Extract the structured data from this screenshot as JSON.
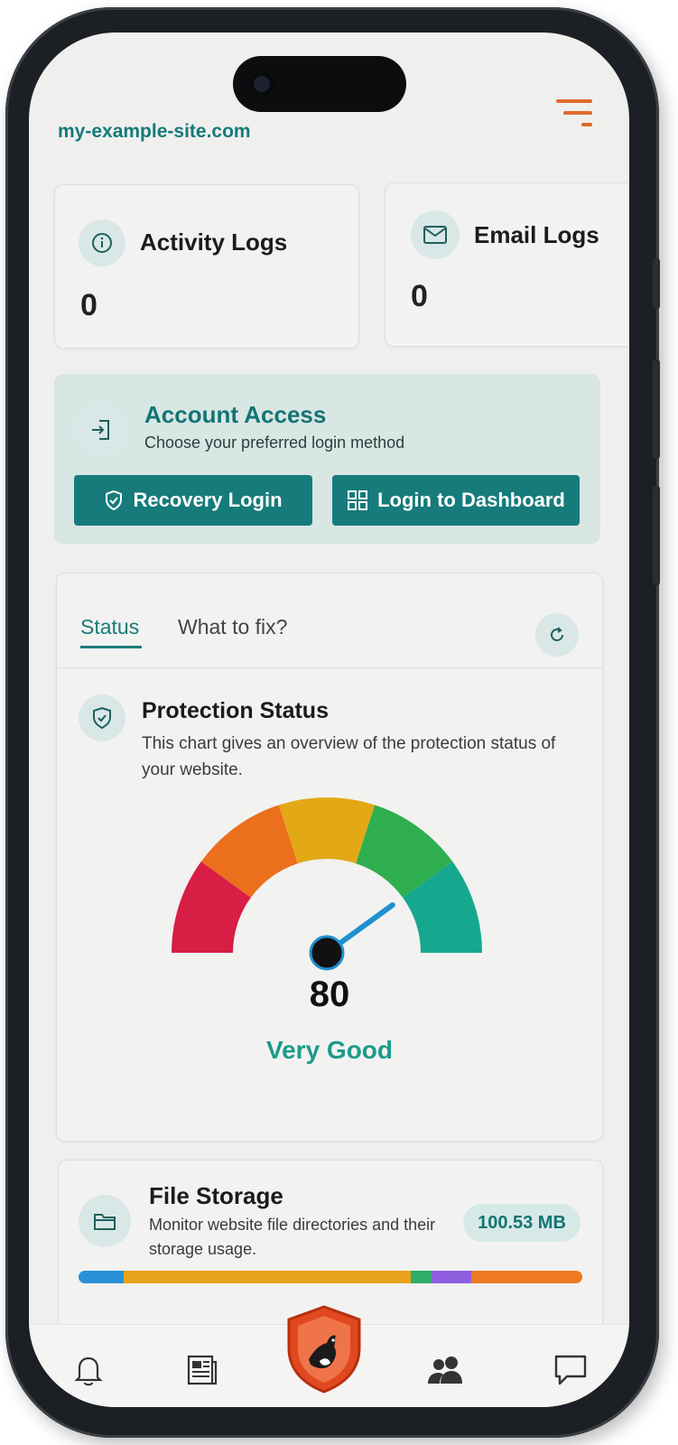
{
  "header": {
    "site_url": "my-example-site.com",
    "menu_icon": "hamburger-menu-icon"
  },
  "log_cards": [
    {
      "title": "Activity Logs",
      "count": "0",
      "icon": "info-icon"
    },
    {
      "title": "Email Logs",
      "count": "0",
      "icon": "mail-icon"
    }
  ],
  "account_access": {
    "title": "Account Access",
    "subtitle": "Choose your preferred login method",
    "icon": "login-icon",
    "recovery_label": "Recovery Login",
    "dashboard_label": "Login to Dashboard"
  },
  "status_panel": {
    "tabs": [
      "Status",
      "What to fix?"
    ],
    "active_tab": "Status",
    "title": "Protection Status",
    "description": "This chart gives an overview of the protection status of your website.",
    "gauge": {
      "value": 80,
      "value_text": "80",
      "max": 100,
      "label": "Very Good",
      "segments": [
        "#d81e45",
        "#ec6f1d",
        "#e3a816",
        "#2eae4f",
        "#16a88e"
      ]
    }
  },
  "file_storage": {
    "title": "File Storage",
    "description": "Monitor website file directories and their storage usage.",
    "size": "100.53 MB",
    "usage_segments": [
      {
        "color": "#2a90d6",
        "fraction": 0.09
      },
      {
        "color": "#e8a21a",
        "fraction": 0.57
      },
      {
        "color": "#2fae6a",
        "fraction": 0.04
      },
      {
        "color": "#8f5fe0",
        "fraction": 0.08
      },
      {
        "color": "#ee7a22",
        "fraction": 0.22
      }
    ]
  },
  "colors": {
    "accent": "#177b7b",
    "menu_accent": "#e06a2a",
    "logo_accent": "#e0481f"
  },
  "bottom_nav": [
    "bell-icon",
    "news-icon",
    "shield-logo-icon",
    "users-icon",
    "chat-icon"
  ]
}
